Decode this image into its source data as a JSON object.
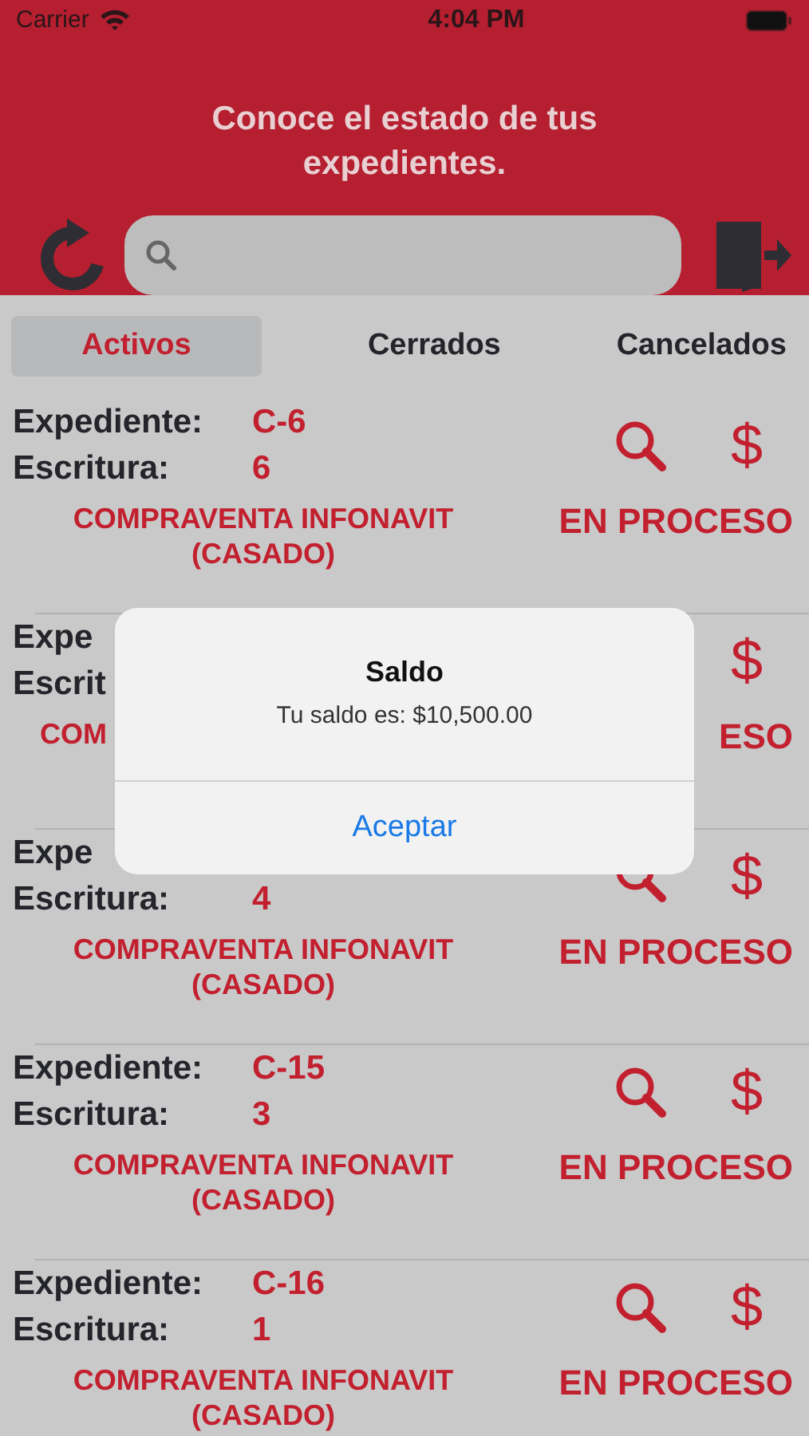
{
  "status_bar": {
    "carrier": "Carrier",
    "time": "4:04 PM"
  },
  "header": {
    "title": "Conoce el estado de tus expedientes."
  },
  "tabs": [
    {
      "label": "Activos",
      "selected": true
    },
    {
      "label": "Cerrados",
      "selected": false
    },
    {
      "label": "Cancelados",
      "selected": false
    }
  ],
  "rows": [
    {
      "expediente_label": "Expediente:",
      "expediente_value": "C-6",
      "escritura_label": "Escritura:",
      "escritura_value": "6",
      "tipo": "COMPRAVENTA INFONAVIT (CASADO)",
      "estado": "EN PROCESO",
      "actions": [
        {
          "kind": "search"
        },
        {
          "kind": "balance",
          "symbol": "$"
        }
      ]
    },
    {
      "expediente_label": "Expe",
      "escritura_label": "Escrit",
      "tipo": "COM",
      "estado": "ESO",
      "actions": [
        {
          "kind": "balance",
          "symbol": "$"
        }
      ]
    },
    {
      "expediente_label": "Expe",
      "escritura_label": "Escritura:",
      "escritura_value": "4",
      "tipo": "COMPRAVENTA INFONAVIT (CASADO)",
      "estado": "EN PROCESO",
      "actions": [
        {
          "kind": "search"
        },
        {
          "kind": "balance",
          "symbol": "$"
        }
      ]
    },
    {
      "expediente_label": "Expediente:",
      "expediente_value": "C-15",
      "escritura_label": "Escritura:",
      "escritura_value": "3",
      "tipo": "COMPRAVENTA INFONAVIT (CASADO)",
      "estado": "EN PROCESO",
      "actions": [
        {
          "kind": "search"
        },
        {
          "kind": "balance",
          "symbol": "$"
        }
      ]
    },
    {
      "expediente_label": "Expediente:",
      "expediente_value": "C-16",
      "escritura_label": "Escritura:",
      "escritura_value": "1",
      "tipo": "COMPRAVENTA INFONAVIT (CASADO)",
      "estado": "EN PROCESO",
      "actions": [
        {
          "kind": "search"
        },
        {
          "kind": "balance",
          "symbol": "$"
        }
      ]
    }
  ],
  "alert": {
    "title": "Saldo",
    "message": "Tu saldo es: $10,500.00",
    "button": "Aceptar"
  }
}
